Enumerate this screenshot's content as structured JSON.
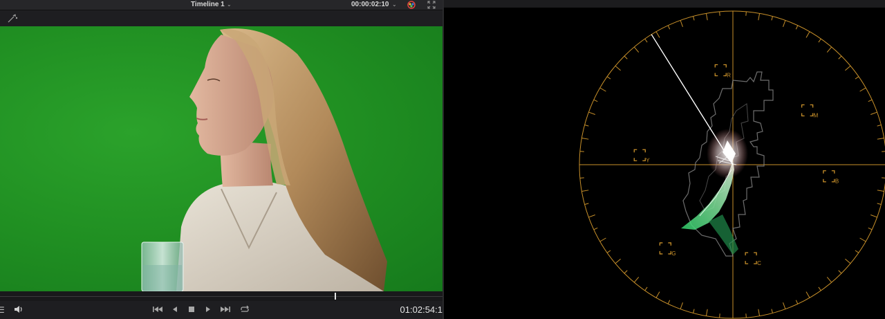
{
  "viewer": {
    "timeline_title": "Timeline 1",
    "timecode": "00:00:02:10",
    "current_timecode": "01:02:54:1",
    "playhead_fraction": 0.757
  },
  "vectorscope": {
    "targets": [
      {
        "key": "R",
        "label": "R"
      },
      {
        "key": "M",
        "label": "M"
      },
      {
        "key": "Y",
        "label": "Y"
      },
      {
        "key": "B",
        "label": "B"
      },
      {
        "key": "G",
        "label": "G"
      },
      {
        "key": "C",
        "label": "C"
      }
    ],
    "graticule_color": "#c8902a",
    "skin_tone_line_color": "#ffffff"
  },
  "icons": {
    "timeline_dropdown": "chevron-down-icon",
    "timecode_dropdown": "chevron-down-icon",
    "color_wheel": "color-wheel-icon",
    "fullscreen": "expand-icon",
    "magic_wand": "wand-icon",
    "audio": "speaker-icon",
    "first_frame": "skip-to-start-icon",
    "reverse": "play-reverse-icon",
    "stop": "stop-icon",
    "play": "play-icon",
    "last_frame": "skip-to-end-icon",
    "loop": "loop-icon"
  }
}
